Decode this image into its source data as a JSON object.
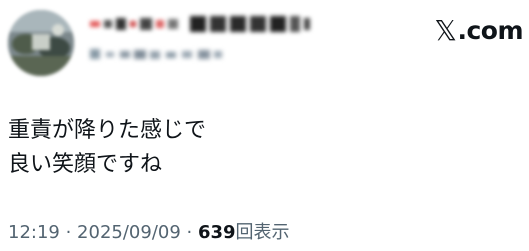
{
  "brand": {
    "icon": "x-logo-icon",
    "mark": "𝕏",
    "domain": ".com"
  },
  "tweet": {
    "lines": [
      "重責が降りた感じで",
      "良い笑顔ですね"
    ]
  },
  "meta": {
    "time": "12:19",
    "separator": " · ",
    "date": "2025/09/09",
    "views_count": "639",
    "views_label": "回表示"
  },
  "colors": {
    "text_primary": "#0f1419",
    "text_secondary": "#536471",
    "background": "#ffffff"
  }
}
